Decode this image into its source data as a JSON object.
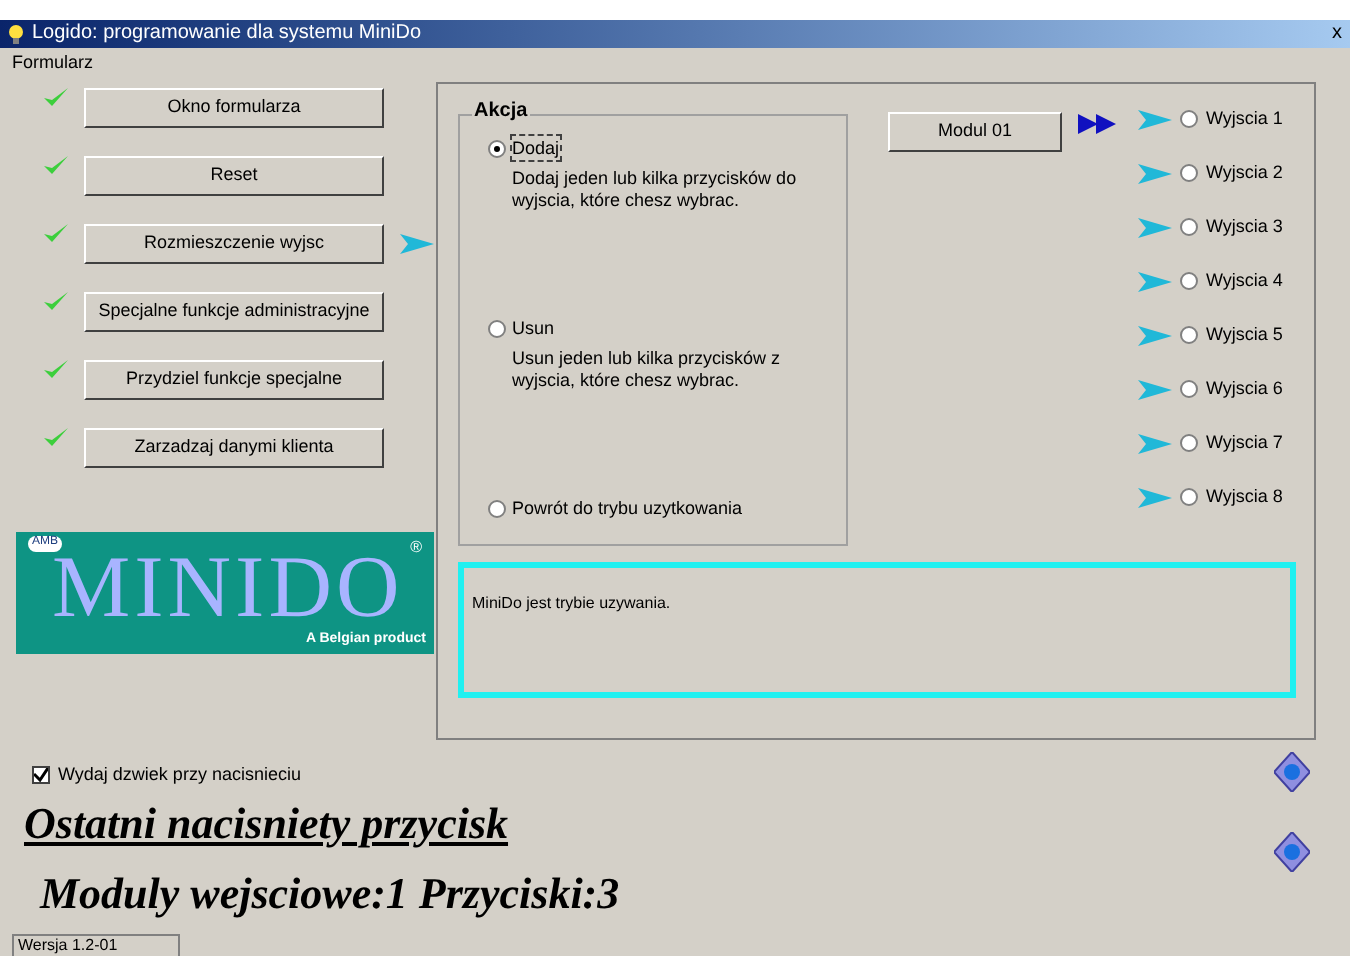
{
  "window": {
    "title": "Logido: programowanie dla systemu MiniDo",
    "close": "x"
  },
  "menu": [
    "Formularz"
  ],
  "nav_buttons": [
    {
      "label": "Okno formularza",
      "selected": false
    },
    {
      "label": "Reset",
      "selected": false
    },
    {
      "label": "Rozmieszczenie wyjsc",
      "selected": true
    },
    {
      "label": "Specjalne funkcje administracyjne",
      "selected": false
    },
    {
      "label": "Przydziel funkcje specjalne",
      "selected": false
    },
    {
      "label": "Zarzadzaj danymi klienta",
      "selected": false
    }
  ],
  "logo": {
    "badge": "AMB",
    "name": "MINIDO",
    "mark": "®",
    "tagline": "A Belgian product"
  },
  "akcja": {
    "title": "Akcja",
    "options": [
      {
        "label": "Dodaj",
        "description": "Dodaj jeden lub kilka przycisków do wyjscia, które chesz wybrac.",
        "selected": true
      },
      {
        "label": "Usun",
        "description": "Usun jeden lub kilka przycisków z wyjscia, które chesz wybrac.",
        "selected": false
      },
      {
        "label": "Powrót do trybu uzytkowania",
        "selected": false
      }
    ]
  },
  "module_button": "Modul 01",
  "outputs": [
    {
      "label": "Wyjscia 1",
      "selected": false
    },
    {
      "label": "Wyjscia 2",
      "selected": false
    },
    {
      "label": "Wyjscia 3",
      "selected": false
    },
    {
      "label": "Wyjscia 4",
      "selected": false
    },
    {
      "label": "Wyjscia 5",
      "selected": false
    },
    {
      "label": "Wyjscia 6",
      "selected": false
    },
    {
      "label": "Wyjscia 7",
      "selected": false
    },
    {
      "label": "Wyjscia 8",
      "selected": false
    }
  ],
  "message": "MiniDo jest trybie uzywania.",
  "sound_checkbox": {
    "label": "Wydaj dzwiek przy nacisnieciu",
    "checked": true
  },
  "last_button_heading": "Ostatni nacisniety przycisk",
  "last_button_info": "Moduly wejsciowe:1 Przyciski:3",
  "status_bar": "Wersja 1.2-01"
}
